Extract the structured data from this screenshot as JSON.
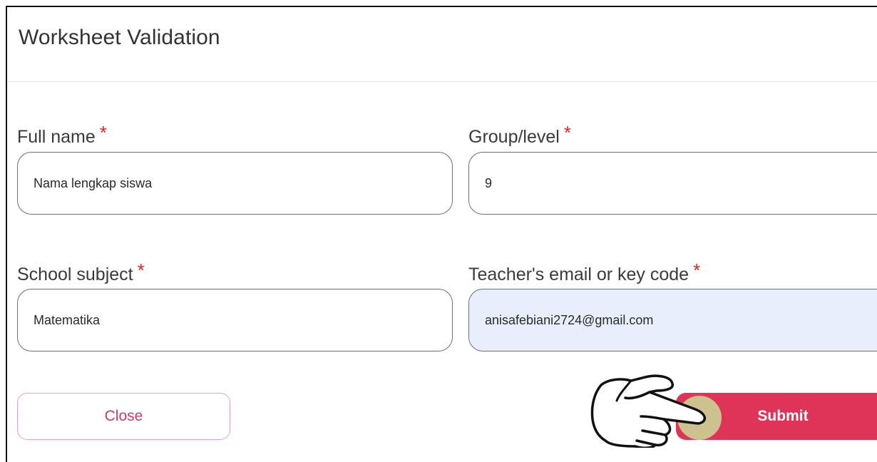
{
  "dialog": {
    "title": "Worksheet Validation"
  },
  "form": {
    "full_name": {
      "label": "Full name",
      "required_mark": "*",
      "value": "Nama lengkap siswa"
    },
    "group_level": {
      "label": "Group/level",
      "required_mark": "*",
      "value": "9"
    },
    "school_subject": {
      "label": "School subject",
      "required_mark": "*",
      "value": "Matematika"
    },
    "teacher_email": {
      "label": "Teacher's email or key code",
      "required_mark": "*",
      "value": "anisafebiani2724@gmail.com"
    }
  },
  "actions": {
    "close_label": "Close",
    "submit_label": "Submit"
  },
  "colors": {
    "accent": "#dd3458",
    "required": "#e02424",
    "autofill_background": "#e8eefb",
    "tap_indicator": "#cdc28f"
  },
  "icons": {
    "pointer": "pointing-hand-icon"
  }
}
